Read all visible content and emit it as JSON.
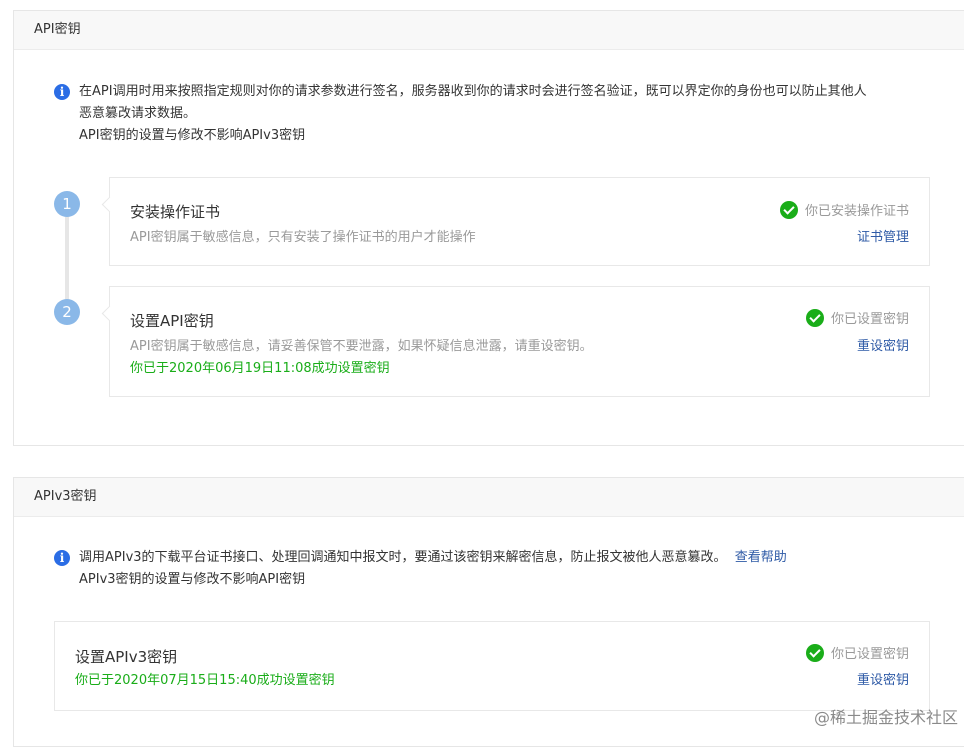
{
  "api_section": {
    "title": "API密钥",
    "info_line1": "在API调用时用来按照指定规则对你的请求参数进行签名，服务器收到你的请求时会进行签名验证，既可以界定你的身份也可以防止其他人",
    "info_line2": "恶意篡改请求数据。",
    "info_line3": "API密钥的设置与修改不影响APIv3密钥",
    "steps": [
      {
        "number": "1",
        "title": "安装操作证书",
        "desc": "API密钥属于敏感信息，只有安装了操作证书的用户才能操作",
        "status": "你已安装操作证书",
        "action": "证书管理"
      },
      {
        "number": "2",
        "title": "设置API密钥",
        "desc": "API密钥属于敏感信息，请妥善保管不要泄露，如果怀疑信息泄露，请重设密钥。",
        "success": "你已于2020年06月19日11:08成功设置密钥",
        "status": "你已设置密钥",
        "action": "重设密钥"
      }
    ]
  },
  "apiv3_section": {
    "title": "APIv3密钥",
    "info_line1": "调用APIv3的下载平台证书接口、处理回调通知中报文时，要通过该密钥来解密信息，防止报文被他人恶意篡改。",
    "help_link": "查看帮助",
    "info_line2": "APIv3密钥的设置与修改不影响API密钥",
    "card": {
      "title": "设置APIv3密钥",
      "success": "你已于2020年07月15日15:40成功设置密钥",
      "status": "你已设置密钥",
      "action": "重设密钥"
    }
  },
  "watermark": "@稀土掘金技术社区",
  "colors": {
    "accent_blue": "#2b6de5",
    "link": "#2e5aa6",
    "success_green": "#1aad19",
    "step_blue": "#8ab8e8"
  },
  "icons": {
    "info": "info-icon",
    "check": "check-circle-icon"
  }
}
